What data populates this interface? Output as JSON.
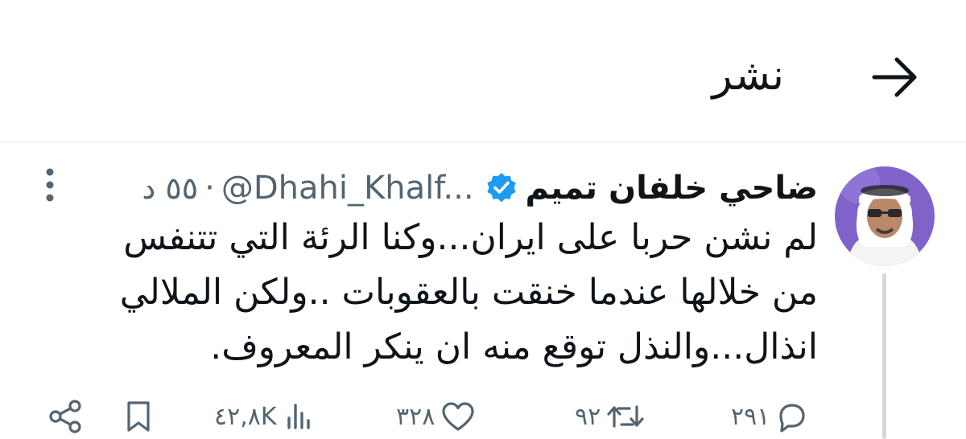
{
  "header": {
    "title": "نشر",
    "back_icon": "arrow-right-icon"
  },
  "tweet": {
    "author_name": "ضاحي خلفان تميم",
    "handle": "@Dhahi_Khalf...",
    "separator": "·",
    "time": "٥٥ د",
    "verified_color": "#1d9bf0",
    "text": "لم نشن حربا على ايران...وكنا الرئة التي تتنفس من خلالها عندما خنقت بالعقوبات ..ولكن الملالي انذال...والنذل توقع منه ان ينكر المعروف.",
    "avatar_bg": "#7f63c9"
  },
  "actions": {
    "replies": "٢٩١",
    "retweets": "٩٢",
    "likes": "٣٢٨",
    "views": "٤٢,٨K"
  },
  "colors": {
    "text": "#0f1419",
    "secondary": "#536471",
    "divider": "#eff3f4",
    "thread": "#cfd9de"
  }
}
